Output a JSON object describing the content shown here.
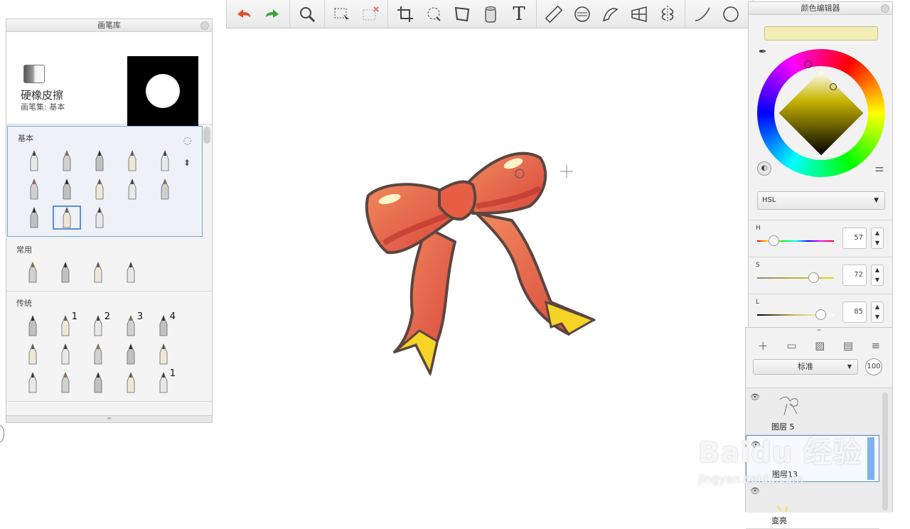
{
  "toolbar": {
    "tools": [
      "undo-icon",
      "redo-icon",
      "zoom-icon",
      "select-icon",
      "select-subtract-icon",
      "crop-icon",
      "lasso-icon",
      "transform-icon",
      "fill-bucket-icon",
      "text-icon",
      "ruler-icon",
      "ellipse-guide-icon",
      "french-curve-icon",
      "perspective-icon",
      "symmetry-icon",
      "curve-icon",
      "circle-icon"
    ],
    "text_tool_label": "T"
  },
  "brush_library": {
    "title": "画笔库",
    "current_brush": "硬橡皮擦",
    "current_set": "画笔集: 基本",
    "categories": [
      {
        "label": "基本",
        "count": 13,
        "selected_index": 11
      },
      {
        "label": "常用",
        "count": 4
      },
      {
        "label": "传统",
        "count": 15,
        "numbers": [
          "1",
          "2",
          "3",
          "4",
          "1"
        ]
      }
    ]
  },
  "color_editor": {
    "title": "颜色编辑器",
    "current_color": "#f3eeb3",
    "model": "HSL",
    "sliders": [
      {
        "label": "H",
        "value": "57",
        "pos": 0.16
      },
      {
        "label": "S",
        "value": "72",
        "pos": 0.72
      },
      {
        "label": "L",
        "value": "85",
        "pos": 0.82
      }
    ]
  },
  "layers": {
    "blend_mode": "标准",
    "opacity": "100",
    "items": [
      {
        "name": "图层 5",
        "selected": false
      },
      {
        "name": "图层13",
        "selected": true
      },
      {
        "name": "变亮",
        "selected": false
      }
    ]
  },
  "watermark": {
    "line1": "Baidu 经验",
    "line2": "jingyan.baidu.com"
  }
}
